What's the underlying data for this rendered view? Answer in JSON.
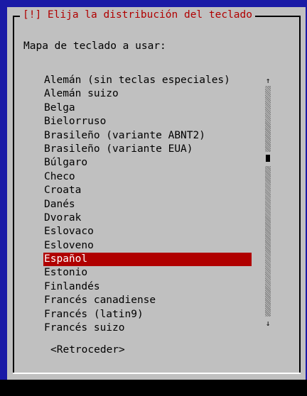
{
  "dialog": {
    "title": "[!] Elija la distribución del teclado",
    "prompt": "Mapa de teclado a usar:",
    "back_button": "<Retroceder>"
  },
  "keymap_list": {
    "items": [
      "Alemán (sin teclas especiales)",
      "Alemán suizo",
      "Belga",
      "Bielorruso",
      "Brasileño (variante ABNT2)",
      "Brasileño (variante EUA)",
      "Búlgaro",
      "Checo",
      "Croata",
      "Danés",
      "Dvorak",
      "Eslovaco",
      "Esloveno",
      "Español",
      "Estonio",
      "Finlandés",
      "Francés canadiense",
      "Francés (latin9)",
      "Francés suizo"
    ],
    "selected": "Español"
  },
  "scrollbar": {
    "up_arrow": "↑",
    "down_arrow": "↓"
  },
  "colors": {
    "background": "#1a1aa6",
    "dialog": "#c0c0c0",
    "accent": "#b00000",
    "selected_text": "#ffffff"
  }
}
